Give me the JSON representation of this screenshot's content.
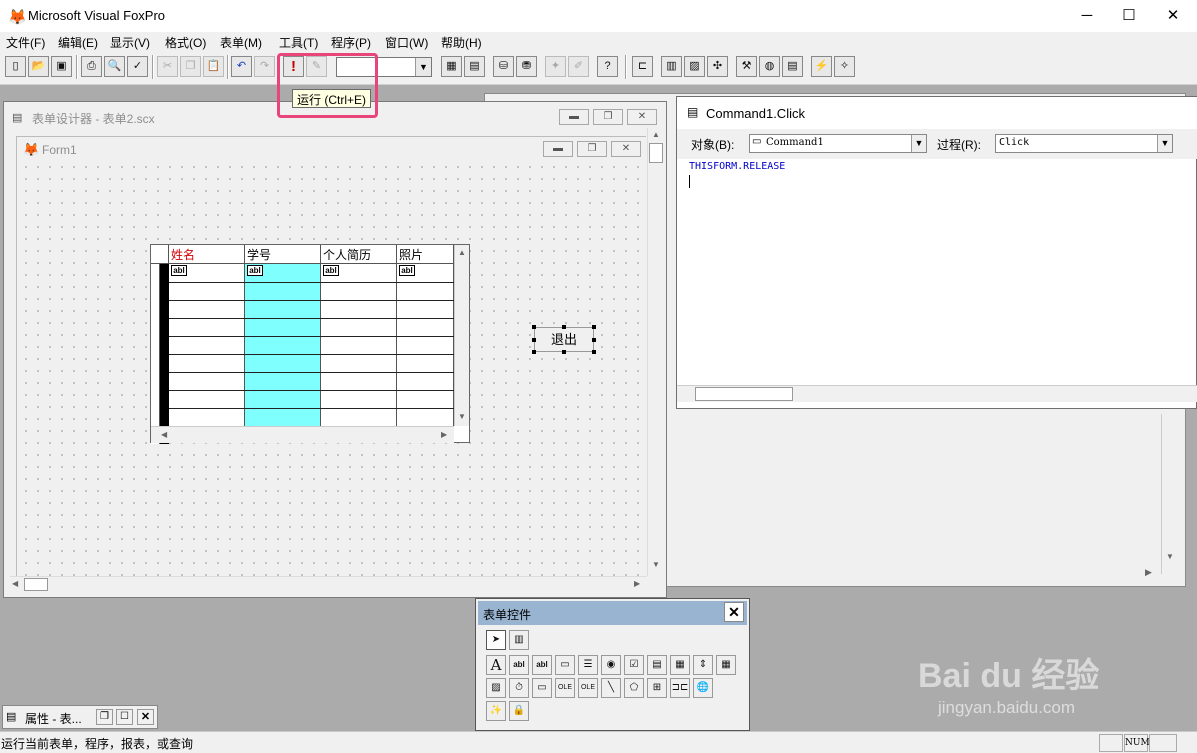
{
  "app": {
    "title": "Microsoft Visual FoxPro"
  },
  "menu": [
    "文件(F)",
    "编辑(E)",
    "显示(V)",
    "格式(O)",
    "表单(M)",
    "工具(T)",
    "程序(P)",
    "窗口(W)",
    "帮助(H)"
  ],
  "toolbar": {
    "run_icon": "!",
    "run_tooltip": "运行 (Ctrl+E)",
    "combo_value": ""
  },
  "form_designer": {
    "title": "表单设计器 - 表单2.scx",
    "form_title": "Form1"
  },
  "grid": {
    "headers": [
      "姓名",
      "学号",
      "个人简历",
      "照片"
    ],
    "cell_marker": "abl",
    "highlight_color": "#80ffff",
    "header_first_color": "#d40000"
  },
  "quit_button": {
    "label": "退出"
  },
  "code_window": {
    "title": "Command1.Click",
    "object_label": "对象(B):",
    "object_value": "Command1",
    "procedure_label": "过程(R):",
    "procedure_value": "Click",
    "code": "THISFORM.RELEASE"
  },
  "palette": {
    "title": "表单控件",
    "close": "✕"
  },
  "properties_window": {
    "title": "属性 - 表..."
  },
  "statusbar": {
    "message": "运行当前表单，程序，报表，或查询",
    "num": "NUM"
  },
  "watermark": {
    "brand": "Bai du 经验",
    "url": "jingyan.baidu.com"
  }
}
